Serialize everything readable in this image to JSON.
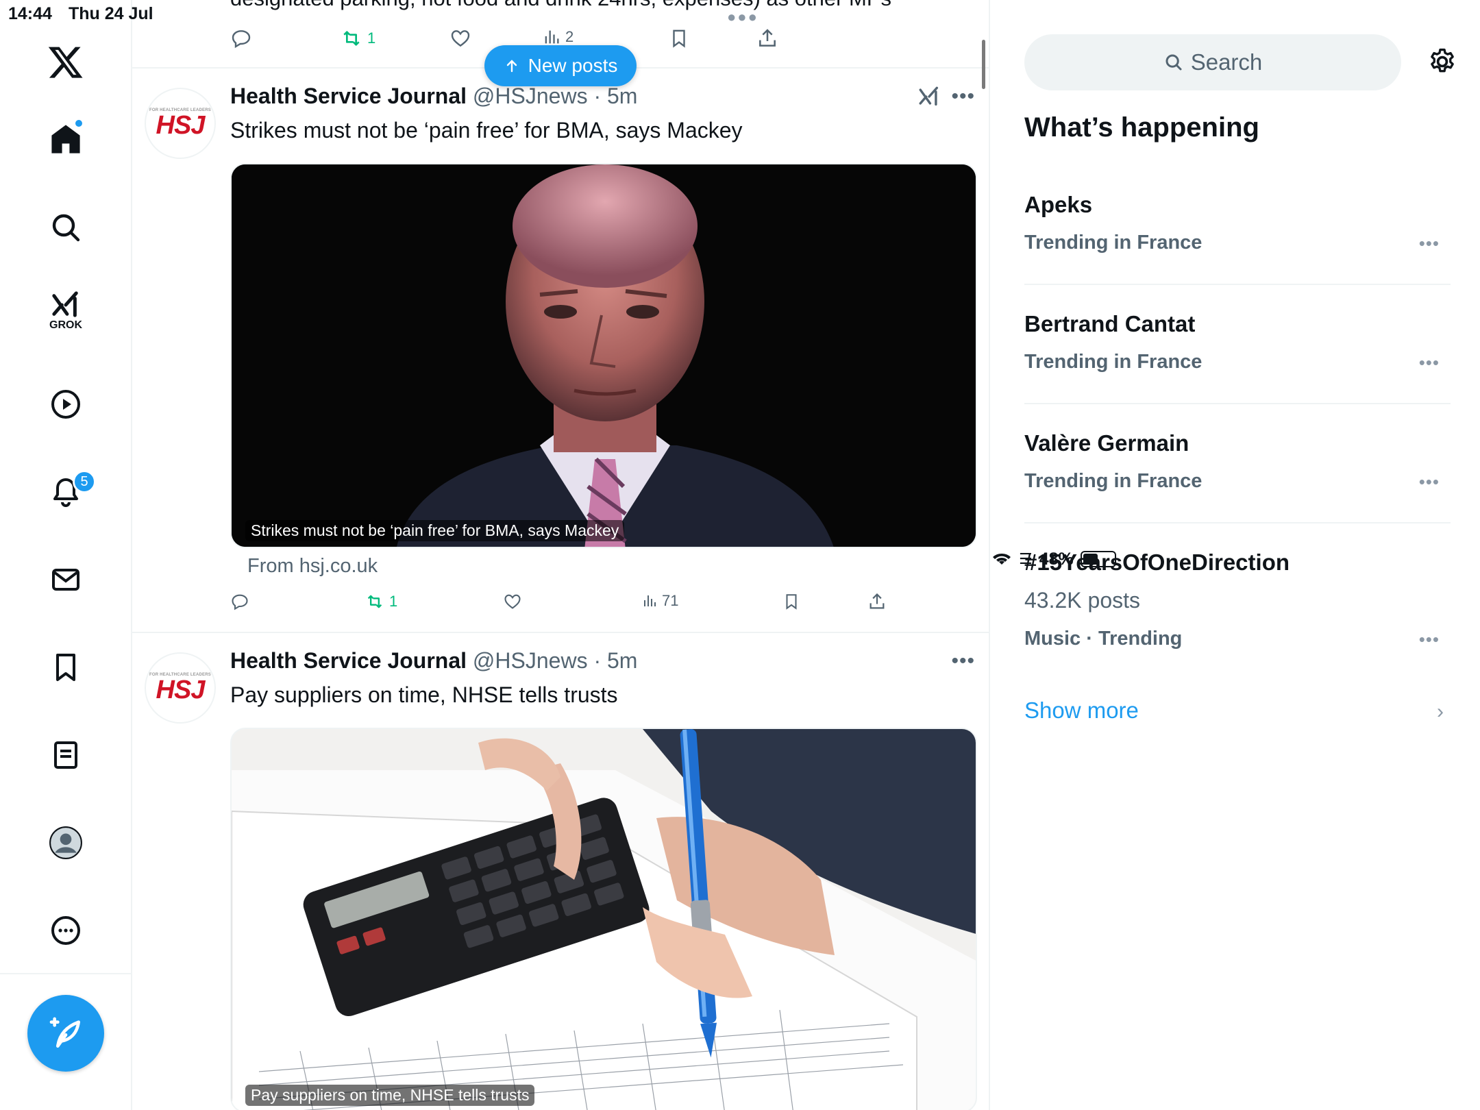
{
  "status_bar": {
    "time": "14:44",
    "date": "Thu 24 Jul",
    "battery": "48%",
    "battery_level": 0.48
  },
  "nav": {
    "items": [
      "home",
      "explore",
      "grok",
      "videos",
      "notifications",
      "messages",
      "bookmarks",
      "lists",
      "profile",
      "more"
    ],
    "grok_label": "GROK",
    "notifications_badge": "5"
  },
  "feed": {
    "prev_tweet_text": "designated parking, not food and drink 24hrs, expenses) as other MPs",
    "prev_tweet_actions": {
      "retweets": "1",
      "views": "2"
    },
    "new_posts_label": "New posts",
    "tweets": [
      {
        "author": "Health Service Journal",
        "handle": "@HSJnews",
        "time": "· 5m",
        "text": "Strikes must not be ‘pain free’ for BMA, says Mackey",
        "media_caption": "Strikes must not be ‘pain free’ for BMA, says Mackey",
        "source": "From hsj.co.uk",
        "retweets": "1",
        "views": "71",
        "avatar_text": "HSJ",
        "avatar_small": "FOR HEALTHCARE LEADERS"
      },
      {
        "author": "Health Service Journal",
        "handle": "@HSJnews",
        "time": "· 5m",
        "text": "Pay suppliers on time, NHSE tells trusts",
        "media_caption": "Pay suppliers on time, NHSE tells trusts",
        "avatar_text": "HSJ",
        "avatar_small": "FOR HEALTHCARE LEADERS"
      }
    ]
  },
  "sidebar": {
    "search_placeholder": "Search",
    "title": "What’s happening",
    "trends": [
      {
        "name": "Apeks",
        "context": "Trending in France"
      },
      {
        "name": "Bertrand Cantat",
        "context": "Trending in France"
      },
      {
        "name": "Valère Germain",
        "context": "Trending in France"
      },
      {
        "name": "#15YearsOfOneDirection",
        "count": "43.2K posts",
        "context": "Music · Trending"
      }
    ],
    "show_more": "Show more"
  },
  "colors": {
    "accent": "#1d9bf0",
    "retweet": "#00ba7c",
    "hsj_red": "#d01426",
    "muted": "#536471"
  }
}
